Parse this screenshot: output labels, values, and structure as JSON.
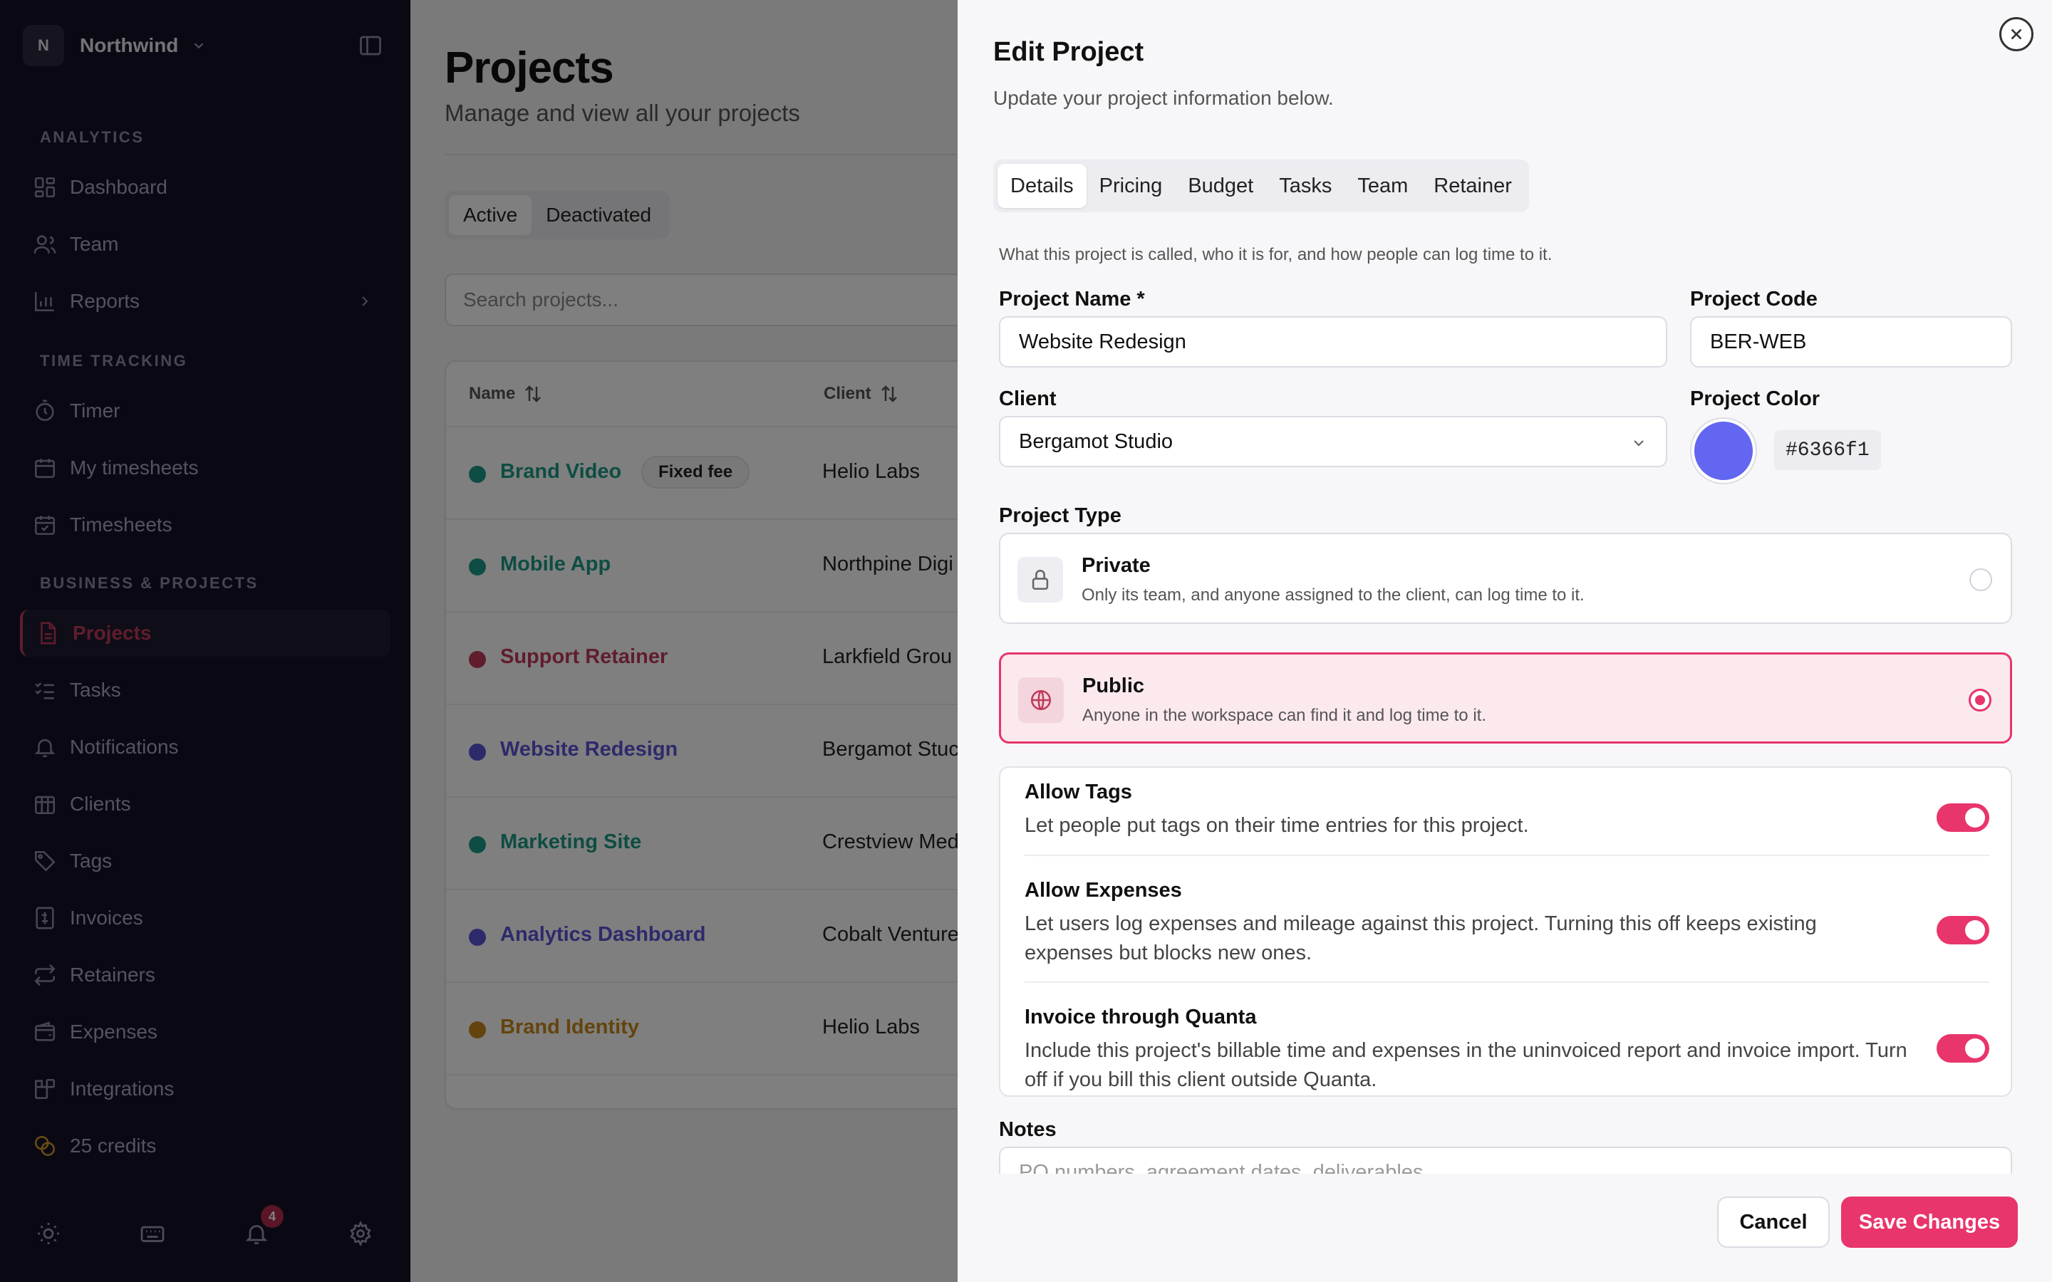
{
  "sidebar": {
    "workspace": {
      "initial": "N",
      "name": "Northwind"
    },
    "sections": [
      {
        "label": "ANALYTICS",
        "items": [
          {
            "label": "Dashboard",
            "icon": "dashboard-icon"
          },
          {
            "label": "Team",
            "icon": "users-icon"
          },
          {
            "label": "Reports",
            "icon": "chart-icon"
          }
        ]
      },
      {
        "label": "TIME TRACKING",
        "items": [
          {
            "label": "Timer",
            "icon": "stopwatch-icon"
          },
          {
            "label": "My timesheets",
            "icon": "calendar-icon"
          },
          {
            "label": "Timesheets",
            "icon": "calendar-check-icon"
          }
        ]
      },
      {
        "label": "BUSINESS & PROJECTS",
        "items": [
          {
            "label": "Projects",
            "icon": "file-icon"
          },
          {
            "label": "Tasks",
            "icon": "list-check-icon"
          },
          {
            "label": "Notifications",
            "icon": "bell-icon"
          },
          {
            "label": "Clients",
            "icon": "building-icon"
          },
          {
            "label": "Tags",
            "icon": "tag-icon"
          },
          {
            "label": "Invoices",
            "icon": "invoice-icon"
          },
          {
            "label": "Retainers",
            "icon": "repeat-icon"
          },
          {
            "label": "Expenses",
            "icon": "wallet-icon"
          },
          {
            "label": "Integrations",
            "icon": "puzzle-icon"
          },
          {
            "label": "25 credits",
            "icon": "coins-icon"
          }
        ]
      }
    ],
    "active_item": "Projects",
    "notification_count": "4"
  },
  "main": {
    "title": "Projects",
    "subtitle": "Manage and view all your projects",
    "status_tabs": [
      "Active",
      "Deactivated"
    ],
    "search_placeholder": "Search projects...",
    "columns": [
      "Name",
      "Client"
    ],
    "rows": [
      {
        "name": "Brand Video",
        "badge": "Fixed fee",
        "client": "Helio Labs",
        "color": "#1d9b87"
      },
      {
        "name": "Mobile App",
        "badge": "",
        "client": "Northpine Digi",
        "color": "#1d9b87"
      },
      {
        "name": "Support Retainer",
        "badge": "",
        "client": "Larkfield Grou",
        "color": "#c03a5a"
      },
      {
        "name": "Website Redesign",
        "badge": "",
        "client": "Bergamot Stuc",
        "color": "#5b55d6"
      },
      {
        "name": "Marketing Site",
        "badge": "",
        "client": "Crestview Med",
        "color": "#1d9b87"
      },
      {
        "name": "Analytics Dashboard",
        "badge": "",
        "client": "Cobalt Venture",
        "color": "#5b55d6"
      },
      {
        "name": "Brand Identity",
        "badge": "",
        "client": "Helio Labs",
        "color": "#c9891a"
      }
    ]
  },
  "drawer": {
    "title": "Edit Project",
    "subtitle": "Update your project information below.",
    "tabs": [
      "Details",
      "Pricing",
      "Budget",
      "Tasks",
      "Team",
      "Retainer"
    ],
    "selected_tab": "Details",
    "description": "What this project is called, who it is for, and how people can log time to it.",
    "project_name_label": "Project Name *",
    "project_name_value": "Website Redesign",
    "project_code_label": "Project Code",
    "project_code_value": "BER-WEB",
    "client_label": "Client",
    "client_value": "Bergamot Studio",
    "color_label": "Project Color",
    "color_value": "#6366f1",
    "type_label": "Project Type",
    "types": [
      {
        "title": "Private",
        "desc": "Only its team, and anyone assigned to the client, can log time to it.",
        "selected": false
      },
      {
        "title": "Public",
        "desc": "Anyone in the workspace can find it and log time to it.",
        "selected": true
      }
    ],
    "toggles": [
      {
        "title": "Allow Tags",
        "desc": "Let people put tags on their time entries for this project.",
        "on": true
      },
      {
        "title": "Allow Expenses",
        "desc": "Let users log expenses and mileage against this project. Turning this off keeps existing expenses but blocks new ones.",
        "on": true
      },
      {
        "title": "Invoice through Quanta",
        "desc": "Include this project's billable time and expenses in the uninvoiced report and invoice import. Turn off if you bill this client outside Quanta.",
        "on": true
      }
    ],
    "notes_label": "Notes",
    "notes_placeholder": "PO numbers, agreement dates, deliverables...",
    "cancel_label": "Cancel",
    "save_label": "Save Changes"
  },
  "colors": {
    "accent": "#e8356b",
    "project_color": "#6366f1",
    "sidebar_bg": "#141326"
  }
}
